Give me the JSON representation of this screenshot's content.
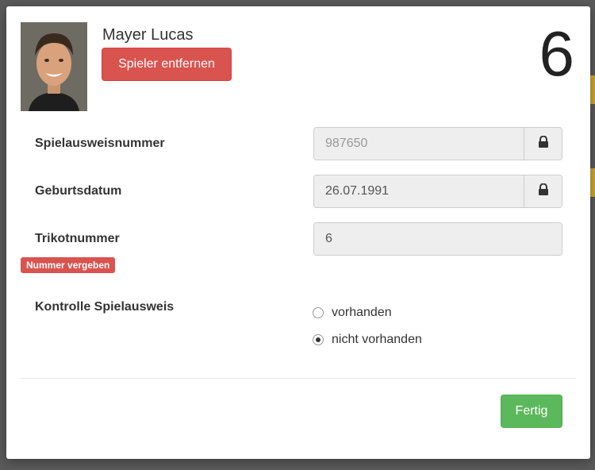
{
  "player": {
    "name": "Mayer Lucas",
    "remove_label": "Spieler entfernen",
    "jersey_display": "6"
  },
  "fields": {
    "pass_number": {
      "label": "Spielausweisnummer",
      "value": "987650",
      "locked": true
    },
    "birthdate": {
      "label": "Geburtsdatum",
      "value": "26.07.1991",
      "locked": true
    },
    "jersey": {
      "label": "Trikotnummer",
      "value": "6"
    }
  },
  "warning_badge": "Nummer vergeben",
  "pass_check": {
    "label": "Kontrolle Spielausweis",
    "options": [
      {
        "label": "vorhanden",
        "selected": false
      },
      {
        "label": "nicht vorhanden",
        "selected": true
      }
    ]
  },
  "done_label": "Fertig",
  "colors": {
    "danger": "#d9534f",
    "success": "#5cb85c"
  },
  "icons": [
    "lock-icon",
    "avatar"
  ]
}
